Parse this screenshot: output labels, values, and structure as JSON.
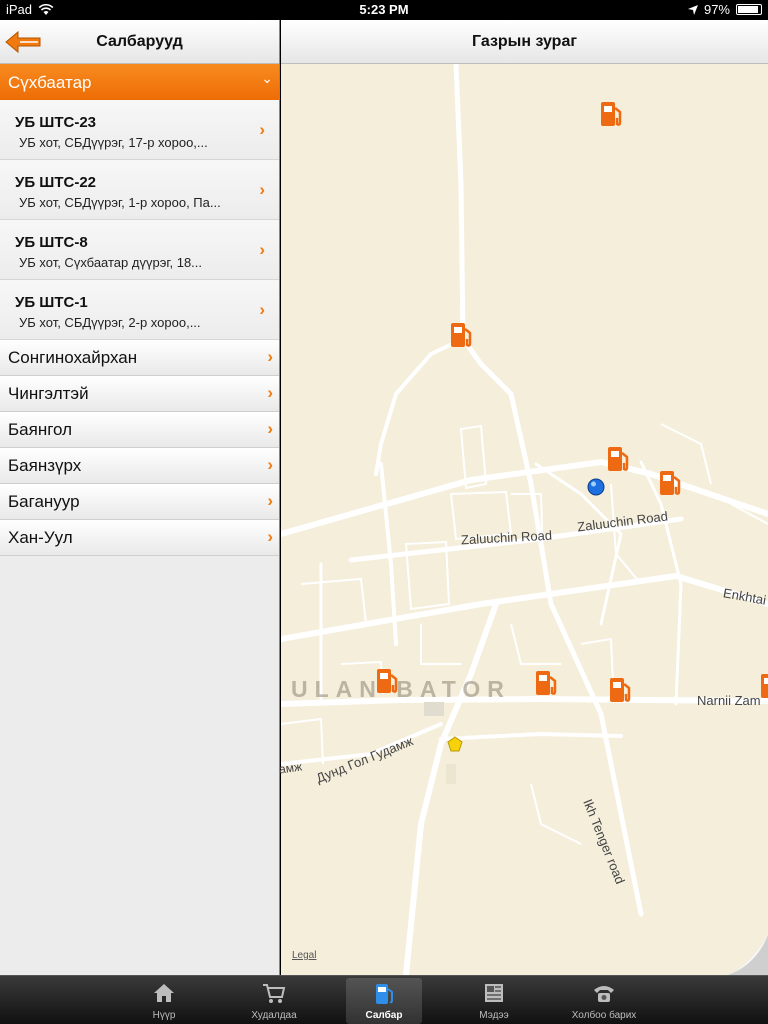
{
  "status": {
    "device": "iPad",
    "time": "5:23 PM",
    "battery": "97%"
  },
  "left": {
    "title": "Салбарууд",
    "open_group": "Сүхбаатар",
    "stations": [
      {
        "name": "УБ ШТС-23",
        "address": "УБ хот, СБДүүрэг, 17-р хороо,..."
      },
      {
        "name": "УБ ШТС-22",
        "address": "УБ хот, СБДүүрэг, 1-р хороо, Па..."
      },
      {
        "name": "УБ ШТС-8",
        "address": "УБ хот, Сүхбаатар дүүрэг, 18..."
      },
      {
        "name": "УБ ШТС-1",
        "address": "УБ хот, СБДүүрэг, 2-р хороо,..."
      }
    ],
    "groups": [
      "Сонгинохайрхан",
      "Чингэлтэй",
      "Баянгол",
      "Баянзүрх",
      "Багануур",
      "Хан-Уул"
    ]
  },
  "right": {
    "title": "Газрын зураг",
    "map_labels": {
      "city": "ULAN BATOR",
      "road1": "Zaluuchin Road",
      "road2": "Zaluuchin Road",
      "road3": "Enkhtai",
      "road4": "Narnii Zam",
      "road5": "Ikh Tenger road",
      "road6": "Дунд Гол Гудамж",
      "road7": "амж"
    },
    "legal": "Legal"
  },
  "tabs": [
    {
      "label": "Нүүр",
      "icon": "home-icon"
    },
    {
      "label": "Худалдаа",
      "icon": "cart-icon"
    },
    {
      "label": "Салбар",
      "icon": "fuel-pump-icon",
      "active": true
    },
    {
      "label": "Мэдээ",
      "icon": "news-icon"
    },
    {
      "label": "Холбоо барих",
      "icon": "phone-icon"
    }
  ],
  "colors": {
    "accent": "#f07a10",
    "map_bg": "#f4eedb",
    "road": "#ffffff",
    "pin": "#ee6a12"
  }
}
